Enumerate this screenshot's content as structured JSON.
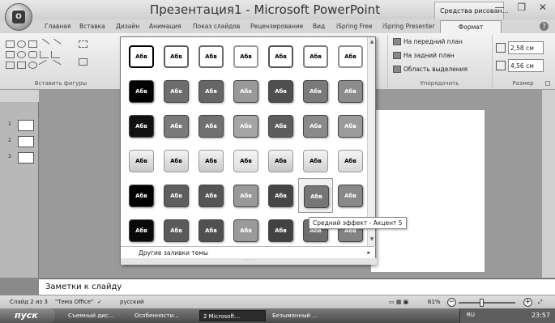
{
  "window": {
    "title": "Презентация1 - Microsoft PowerPoint",
    "context_tab": "Средства рисован...",
    "controls": "— ❐ ✕"
  },
  "office_button": {
    "icon": "office-logo-icon",
    "logo": "O"
  },
  "ribbon_tabs": [
    "Главная",
    "Вставка",
    "Дизайн",
    "Анимация",
    "Показ слайдов",
    "Рецензирование",
    "Вид",
    "iSpring Free",
    "iSpring Presenter"
  ],
  "active_tab": "Формат",
  "help": "?",
  "ribbon": {
    "insert_shapes_label": "Вставить фигуры",
    "arrange": {
      "label": "Упорядочить",
      "bring_front": "На передний план",
      "send_back": "На задний план",
      "selection_pane": "Область выделения"
    },
    "size": {
      "label": "Размер",
      "height": "2,58 см",
      "width": "4,56 см"
    }
  },
  "gallery": {
    "swatch_text": "Абв",
    "rows": [
      {
        "style": "outline",
        "colors": [
          "#000000",
          "#606060",
          "#6b6b6b",
          "#9a9a9a",
          "#555555",
          "#7e7e7e",
          "#8f8f8f"
        ]
      },
      {
        "style": "solid",
        "colors": [
          "#000000",
          "#6d6d6d",
          "#666666",
          "#999999",
          "#4f4f4f",
          "#7a7a7a",
          "#8c8c8c"
        ]
      },
      {
        "style": "subtle",
        "colors": [
          "#111111",
          "#7a7a7a",
          "#707070",
          "#a5a5a5",
          "#5d5d5d",
          "#8a8a8a",
          "#9b9b9b"
        ]
      },
      {
        "style": "light",
        "colors": [
          "#c8c8c8",
          "#cdcdcd",
          "#c8c8c8",
          "#dedede",
          "#c3c3c3",
          "#d2d2d2",
          "#d8d8d8"
        ]
      },
      {
        "style": "moderate",
        "colors": [
          "#000000",
          "#5e5e5e",
          "#555555",
          "#999999",
          "#464646",
          "#767676",
          "#888888"
        ]
      },
      {
        "style": "intense",
        "colors": [
          "#0a0a0a",
          "#5a5a5a",
          "#505050",
          "#9a9a9a",
          "#424242",
          "#6e6e6e",
          "#838383"
        ]
      }
    ],
    "more_fills": "Другие заливки темы",
    "tooltip": "Средний эффект - Акцент 5"
  },
  "notes_placeholder": "Заметки к слайду",
  "slides": [
    {
      "num": "1"
    },
    {
      "num": "2"
    },
    {
      "num": "3"
    }
  ],
  "status": {
    "slide_info": "Слайд 2 из 3",
    "theme": "\"Тема Office\"",
    "language": "русский",
    "zoom": "61%"
  },
  "taskbar": {
    "start": "пуск",
    "tasks": [
      "Съемный дис...",
      "Особенности...",
      "2 Microsoft...",
      "Безымянный ..."
    ],
    "tray_lang": "RU",
    "clock": "23:57"
  }
}
